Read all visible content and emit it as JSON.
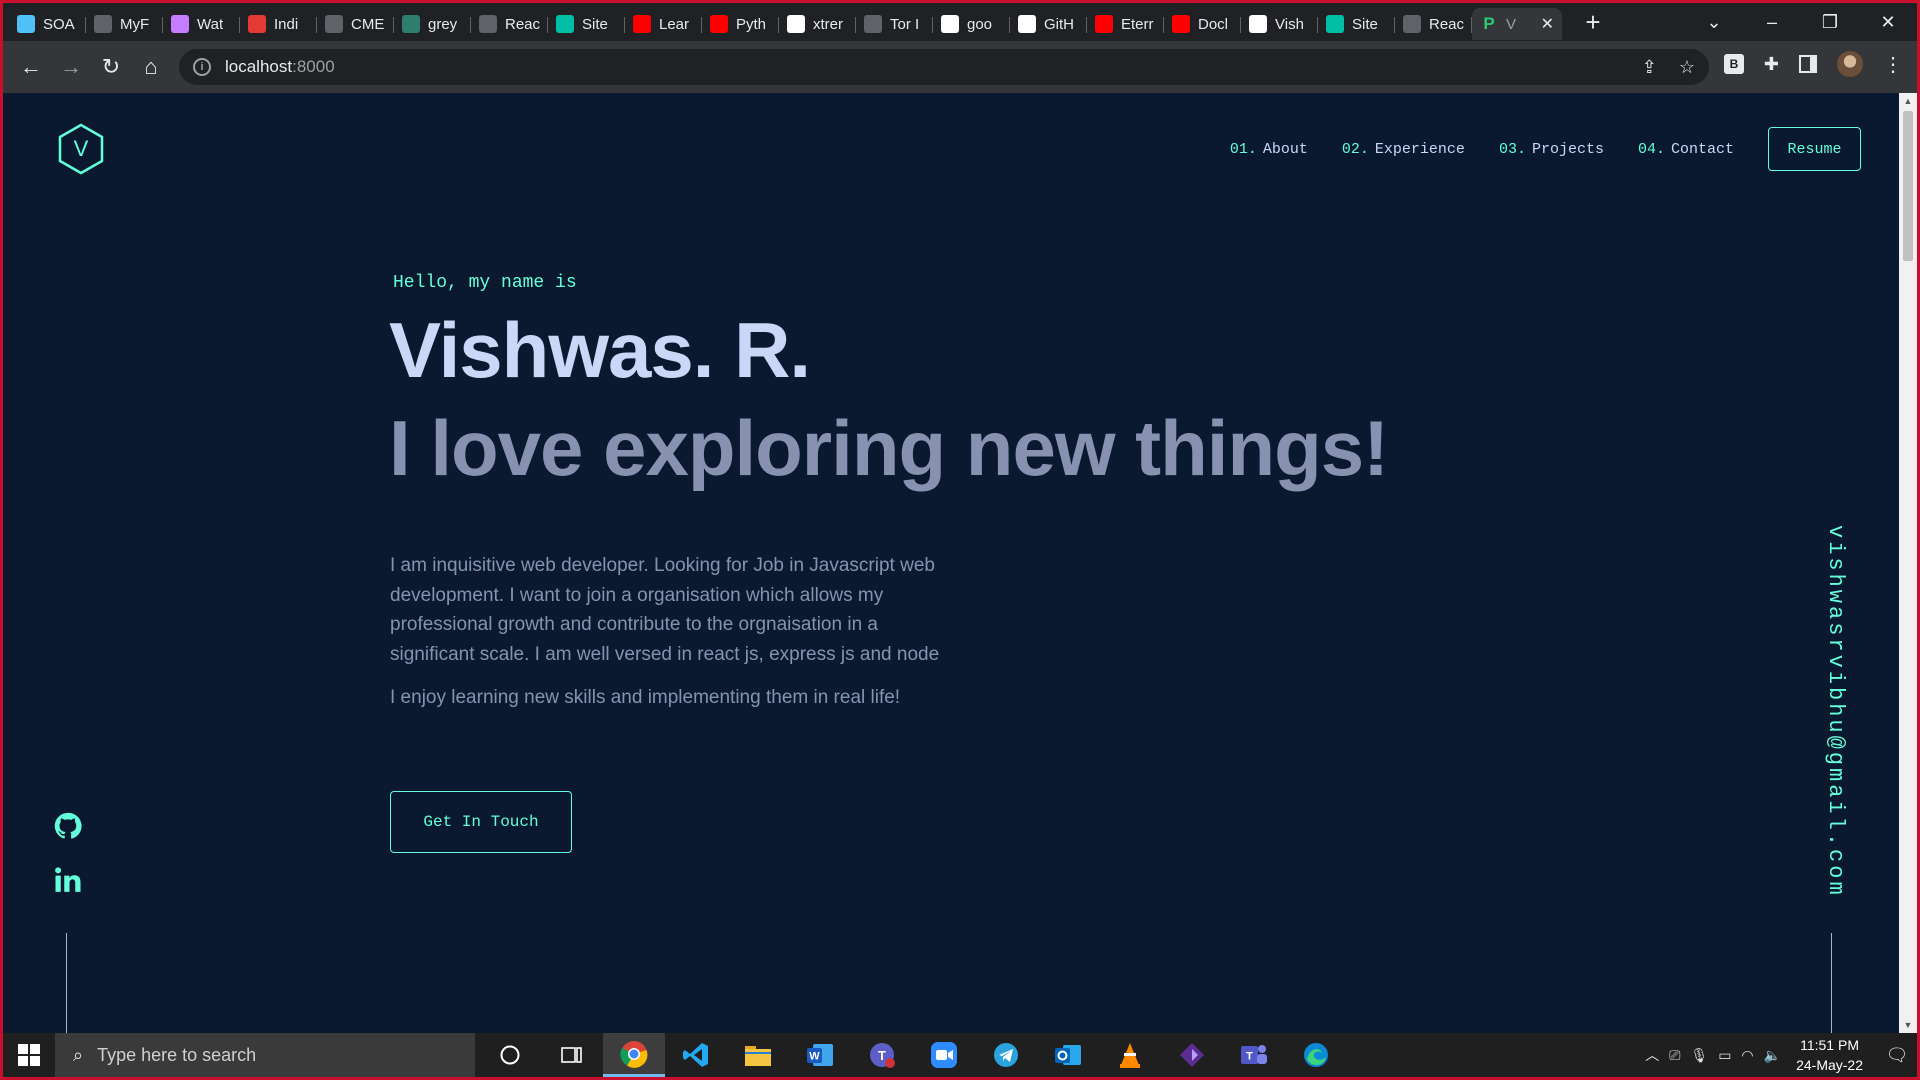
{
  "browser": {
    "tabs": [
      {
        "title": "SOA",
        "icon": "s-icon",
        "color": "#4fc3f7"
      },
      {
        "title": "MyF",
        "icon": "react-icon",
        "color": "#5f6368"
      },
      {
        "title": "Wat",
        "icon": "app-icon",
        "color": "#c77dff"
      },
      {
        "title": "Indi",
        "icon": "grid-icon",
        "color": "#e53935"
      },
      {
        "title": "CME",
        "icon": "lock-icon",
        "color": "#5f6368"
      },
      {
        "title": "grey",
        "icon": "gfg-icon",
        "color": "#2e7d6f"
      },
      {
        "title": "Reac",
        "icon": "react-icon",
        "color": "#5f6368"
      },
      {
        "title": "Site",
        "icon": "diamond-icon",
        "color": "#00bfa5"
      },
      {
        "title": "Lear",
        "icon": "youtube-icon",
        "color": "#ff0000"
      },
      {
        "title": "Pyth",
        "icon": "youtube-icon",
        "color": "#ff0000"
      },
      {
        "title": "xtrer",
        "icon": "google-icon",
        "color": "#ffffff"
      },
      {
        "title": "Tor I",
        "icon": "flame-icon",
        "color": "#5f6368"
      },
      {
        "title": "goo",
        "icon": "github-icon",
        "color": "#ffffff"
      },
      {
        "title": "GitH",
        "icon": "github-icon",
        "color": "#ffffff"
      },
      {
        "title": "Eterr",
        "icon": "youtube-icon",
        "color": "#ff0000"
      },
      {
        "title": "Docl",
        "icon": "youtube-icon",
        "color": "#ff0000"
      },
      {
        "title": "Vish",
        "icon": "github-icon",
        "color": "#ffffff"
      },
      {
        "title": "Site",
        "icon": "diamond-icon",
        "color": "#00bfa5"
      },
      {
        "title": "Reac",
        "icon": "react-icon",
        "color": "#5f6368"
      }
    ],
    "active_tab": {
      "title": "V",
      "icon": "p-icon",
      "letter": "P",
      "color": "#2ecc71",
      "close": "✕"
    },
    "new_tab": "+",
    "url_host": "localhost",
    "url_port": ":8000",
    "ext_letter": "B"
  },
  "page": {
    "logo_letter": "V",
    "nav": [
      {
        "num": "01.",
        "label": "About"
      },
      {
        "num": "02.",
        "label": "Experience"
      },
      {
        "num": "03.",
        "label": "Projects"
      },
      {
        "num": "04.",
        "label": "Contact"
      }
    ],
    "resume_label": "Resume",
    "greeting": "Hello, my name is",
    "name": "Vishwas. R.",
    "tagline": "I love exploring new things!",
    "bio": "I am inquisitive web developer. Looking for Job in Javascript web development. I want to join a organisation which allows my professional growth and contribute to the orgnaisation in a significant scale. I am well versed in react js, express js and node",
    "bio2": "I enjoy learning new skills and implementing them in real life!",
    "cta_label": "Get In Touch",
    "email": "vishwasrvibhu@gmail.com",
    "colors": {
      "background": "#0a192f",
      "accent": "#64ffda",
      "heading": "#ccd6f6",
      "muted": "#8892b0"
    }
  },
  "taskbar": {
    "search_placeholder": "Type here to search",
    "time": "11:51 PM",
    "date": "24-May-22"
  }
}
